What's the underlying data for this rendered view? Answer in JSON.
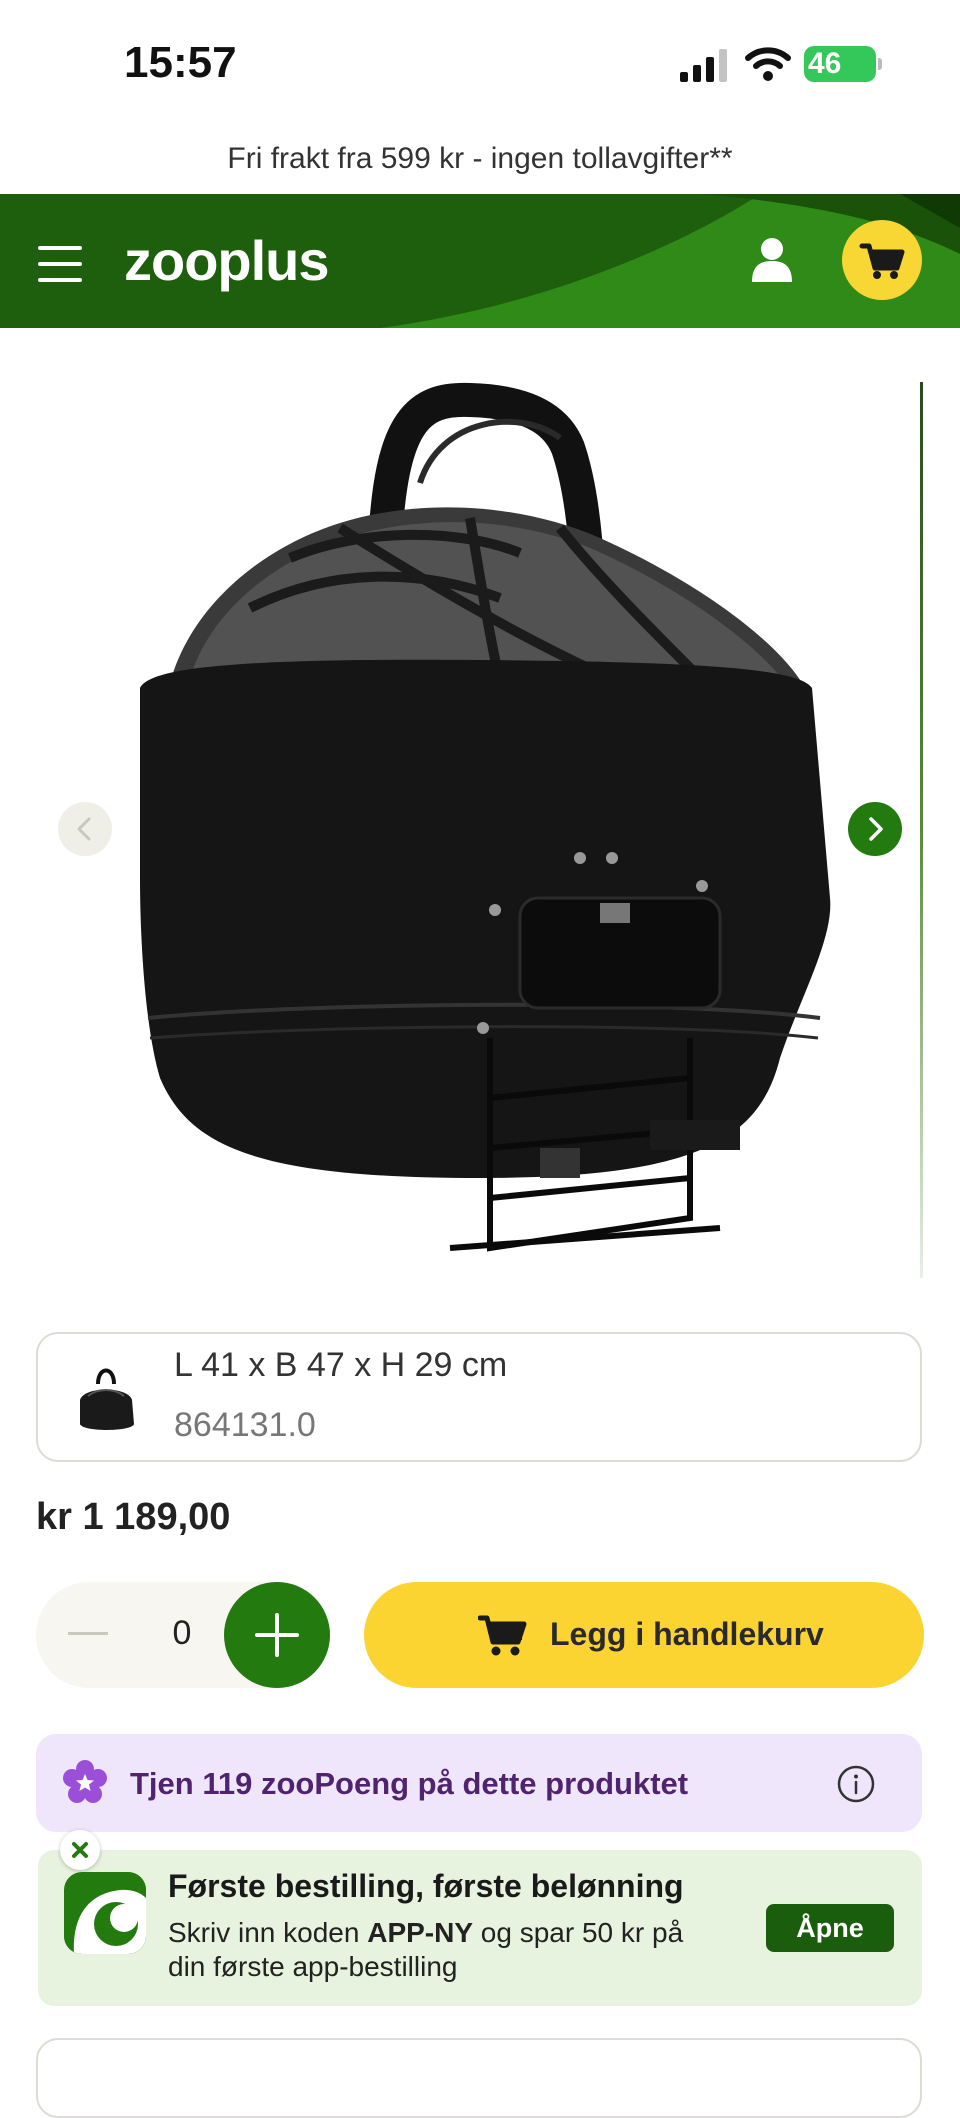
{
  "status_bar": {
    "time": "15:57",
    "battery": "46"
  },
  "promo": {
    "text": "Fri frakt fra 599 kr - ingen tollavgifter**"
  },
  "header": {
    "logo": "zooplus"
  },
  "product": {
    "variant": {
      "size": "L 41 x B 47 x H 29 cm",
      "sku": "864131.0"
    },
    "price": "kr 1 189,00"
  },
  "quantity": {
    "value": "0"
  },
  "add_to_cart": {
    "label": "Legg i handlekurv"
  },
  "loyalty": {
    "text": "Tjen 119 zooPoeng på dette produktet"
  },
  "app_banner": {
    "title": "Første bestilling, første belønning",
    "text_before": "Skriv inn koden ",
    "code": "APP-NY",
    "text_after": " og spar 50 kr på din første app-bestilling",
    "open_label": "Åpne"
  },
  "colors": {
    "brand_green": "#237a0f",
    "header_green": "#1d5f0c",
    "accent_yellow": "#fbd432",
    "loyalty_purple": "#efe6fb",
    "banner_green": "#e8f3df"
  }
}
